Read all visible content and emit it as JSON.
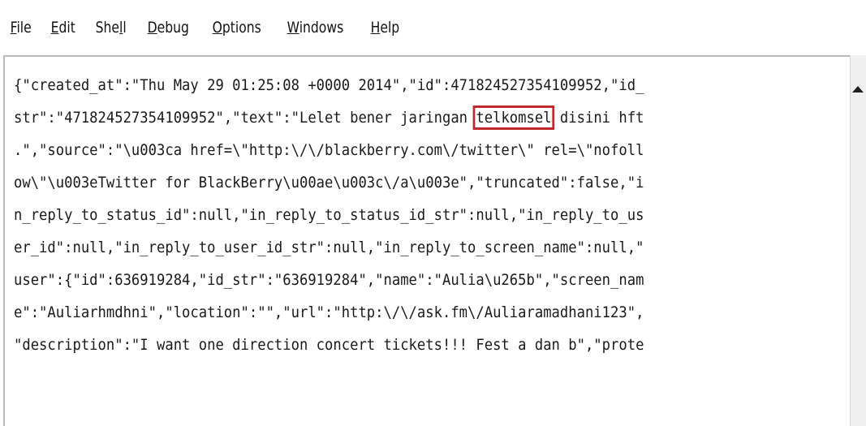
{
  "menu": {
    "items": [
      {
        "pre": "",
        "u": "F",
        "post": "ile"
      },
      {
        "pre": "",
        "u": "E",
        "post": "dit"
      },
      {
        "pre": "She",
        "u": "l",
        "post": "l"
      },
      {
        "pre": "",
        "u": "D",
        "post": "ebug"
      },
      {
        "pre": "",
        "u": "O",
        "post": "ptions"
      },
      {
        "pre": "",
        "u": "W",
        "post": "indows"
      },
      {
        "pre": "",
        "u": "H",
        "post": "elp"
      }
    ]
  },
  "editor": {
    "lines": [
      "{\"created_at\":\"Thu May 29 01:25:08 +0000 2014\",\"id\":471824527354109952,\"id_",
      "str\":\"471824527354109952\",\"text\":\"Lelet bener jaringan ",
      ".\",\"source\":\"\\u003ca href=\\\"http:\\/\\/blackberry.com\\/twitter\\\" rel=\\\"nofoll",
      "ow\\\"\\u003eTwitter for BlackBerry\\u00ae\\u003c\\/a\\u003e\",\"truncated\":false,\"i",
      "n_reply_to_status_id\":null,\"in_reply_to_status_id_str\":null,\"in_reply_to_us",
      "er_id\":null,\"in_reply_to_user_id_str\":null,\"in_reply_to_screen_name\":null,\"",
      "user\":{\"id\":636919284,\"id_str\":\"636919284\",\"name\":\"Aulia\\u265b\",\"screen_nam",
      "e\":\"Auliarhmdhni\",\"location\":\"\",\"url\":\"http:\\/\\/ask.fm\\/Auliaramadhani123\",",
      "\"description\":\"I want one direction concert tickets!!! Fest a dan b\",\"prote"
    ],
    "highlight": "telkomsel",
    "line2_tail": " disini hft"
  },
  "colors": {
    "highlight_border": "#c0282d"
  }
}
